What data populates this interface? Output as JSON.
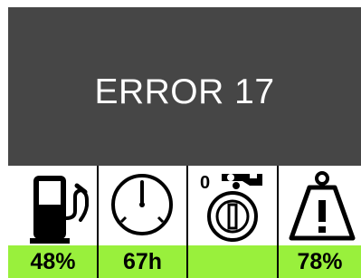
{
  "error": {
    "text": "ERROR 17",
    "panel_color": "#464646"
  },
  "indicators": [
    {
      "icon": "fuel-pump-icon",
      "value": "48%"
    },
    {
      "icon": "speedometer-icon",
      "value": "67h"
    },
    {
      "icon": "ignition-key-icon",
      "icon_label": "0",
      "value": ""
    },
    {
      "icon": "warning-weight-icon",
      "value": "78%"
    }
  ],
  "colors": {
    "value_bar": "#99f03c",
    "icon_background": "#ffffff",
    "stroke": "#000000"
  }
}
